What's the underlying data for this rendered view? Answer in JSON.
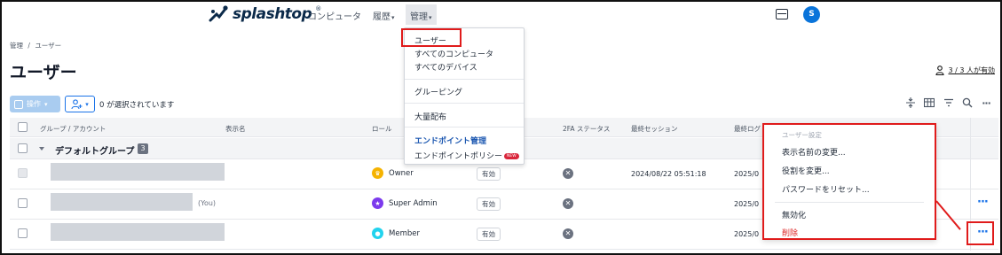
{
  "nav": {
    "brand": "splashtop",
    "items": [
      {
        "label": "コンピュータ"
      },
      {
        "label": "履歴"
      },
      {
        "label": "管理"
      }
    ],
    "avatar_initial": "S"
  },
  "breadcrumb": {
    "parent": "管理",
    "separator": "/",
    "current": "ユーザー"
  },
  "page": {
    "title": "ユーザー",
    "licenses": "3 / 3 人が有効"
  },
  "toolbar": {
    "operation_label": "操作",
    "selection_text": "0 が選択されています"
  },
  "table": {
    "headers": {
      "group_account": "グループ / アカウント",
      "display_name": "表示名",
      "role": "ロール",
      "tfa": "2FA ステータス",
      "last_session": "最終セッション",
      "last_login": "最終ログ"
    },
    "group": {
      "name": "デフォルトグループ",
      "count": "3"
    },
    "rows": [
      {
        "suffix": "",
        "role": "Owner",
        "role_color": "#f5b301",
        "status": "有効",
        "session": "2024/08/22 05:51:18",
        "last_login": "2025/0"
      },
      {
        "suffix": "(You)",
        "role": "Super Admin",
        "role_color": "#7c3aed",
        "status": "有効",
        "session": "",
        "last_login": "2025/0"
      },
      {
        "suffix": "",
        "role": "Member",
        "role_color": "#22d3ee",
        "status": "有効",
        "session": "",
        "last_login": "2025/0"
      }
    ]
  },
  "manage_menu": {
    "users": "ユーザー",
    "all_computers": "すべてのコンピュータ",
    "all_devices": "すべてのデバイス",
    "grouping": "グルーピング",
    "mass_deploy": "大量配布",
    "endpoint_header": "エンドポイント管理",
    "endpoint_policy": "エンドポイントポリシー",
    "new_badge": "NEW"
  },
  "context_menu": {
    "header": "ユーザー設定",
    "change_display_name": "表示名前の変更...",
    "change_role": "役割を変更...",
    "reset_password": "パスワードをリセット...",
    "disable": "無効化",
    "delete": "削除"
  },
  "colors": {
    "accent": "#1a73e8",
    "highlight": "#e01b1b",
    "delete": "#dc2626"
  }
}
